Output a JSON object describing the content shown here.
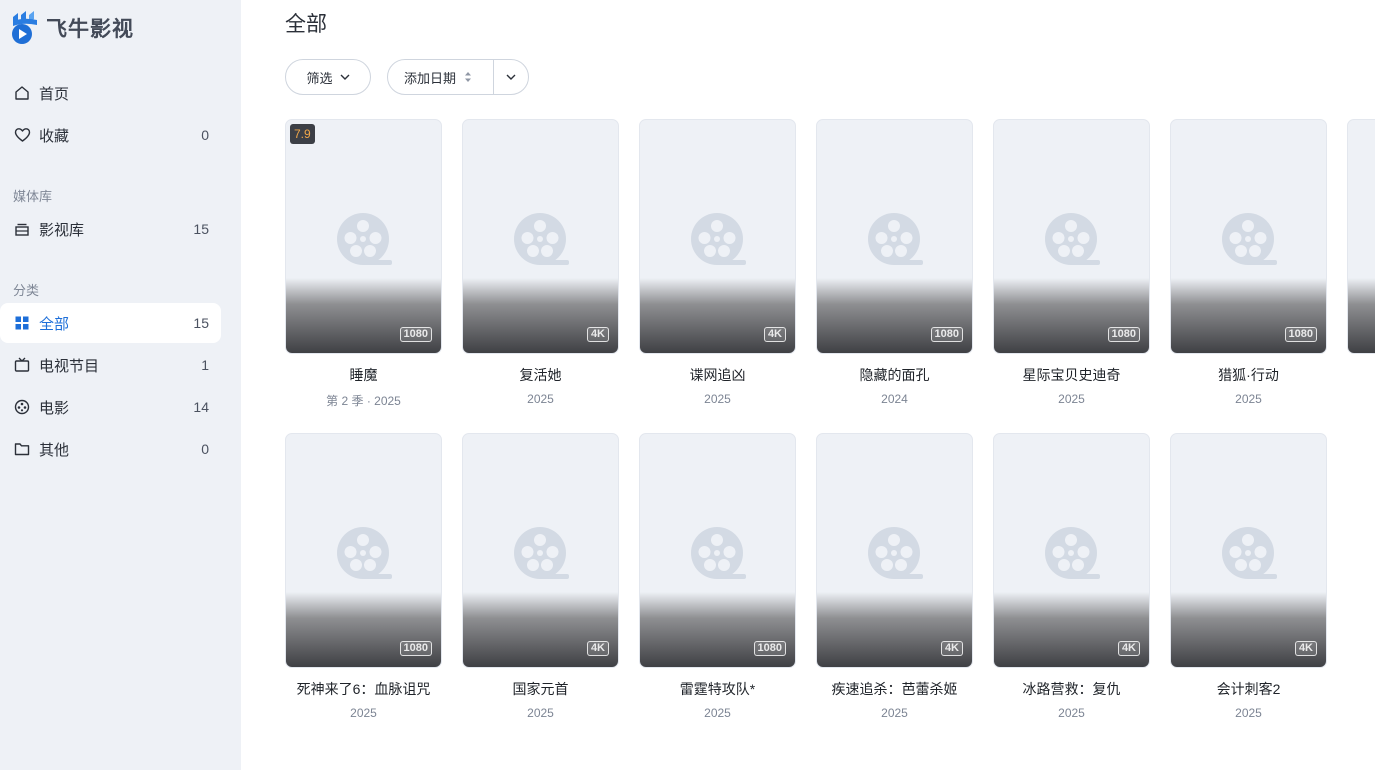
{
  "app": {
    "name": "飞牛影视"
  },
  "sidebar": {
    "nav": [
      {
        "label": "首页",
        "icon": "home-icon",
        "count": ""
      },
      {
        "label": "收藏",
        "icon": "heart-icon",
        "count": "0"
      }
    ],
    "library_section": "媒体库",
    "library": [
      {
        "label": "影视库",
        "icon": "library-icon",
        "count": "15"
      }
    ],
    "category_section": "分类",
    "categories": [
      {
        "label": "全部",
        "icon": "grid-icon",
        "count": "15",
        "active": true
      },
      {
        "label": "电视节目",
        "icon": "tv-icon",
        "count": "1"
      },
      {
        "label": "电影",
        "icon": "film-reel-icon",
        "count": "14"
      },
      {
        "label": "其他",
        "icon": "folder-icon",
        "count": "0"
      }
    ]
  },
  "main": {
    "title": "全部",
    "filter_label": "筛选",
    "sort_label": "添加日期"
  },
  "items": [
    {
      "title": "睡魔",
      "meta": "第 2 季 · 2025",
      "resolution": "1080",
      "rating": "7.9"
    },
    {
      "title": "复活她",
      "meta": "2025",
      "resolution": "4K"
    },
    {
      "title": "谍网追凶",
      "meta": "2025",
      "resolution": "4K"
    },
    {
      "title": "隐藏的面孔",
      "meta": "2024",
      "resolution": "1080"
    },
    {
      "title": "星际宝贝史迪奇",
      "meta": "2025",
      "resolution": "1080"
    },
    {
      "title": "猎狐·行动",
      "meta": "2025",
      "resolution": "1080"
    },
    {
      "title": "死神来了6：血脉诅咒",
      "meta": "2025",
      "resolution": "1080"
    },
    {
      "title": "国家元首",
      "meta": "2025",
      "resolution": "4K"
    },
    {
      "title": "雷霆特攻队*",
      "meta": "2025",
      "resolution": "1080"
    },
    {
      "title": "疾速追杀：芭蕾杀姬",
      "meta": "2025",
      "resolution": "4K"
    },
    {
      "title": "冰路营救：复仇",
      "meta": "2025",
      "resolution": "4K"
    },
    {
      "title": "会计刺客2",
      "meta": "2025",
      "resolution": "4K"
    }
  ],
  "colors": {
    "accent": "#1e6fd9",
    "sidebar_bg": "#eef1f6",
    "rating": "#f0a74a"
  }
}
